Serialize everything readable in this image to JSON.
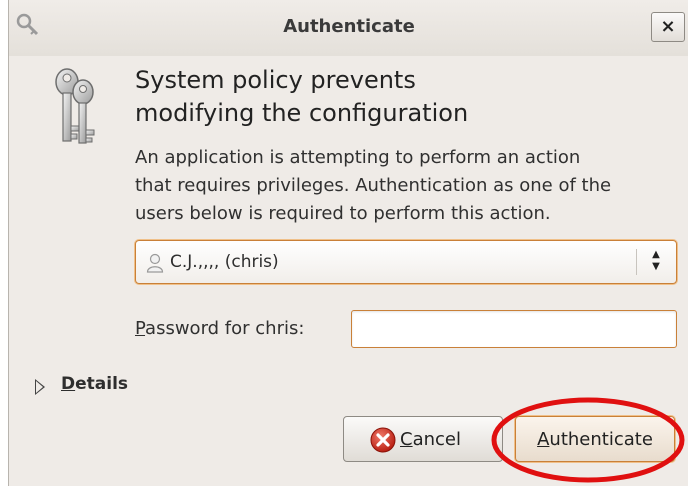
{
  "window": {
    "title": "Authenticate",
    "close_label": "×"
  },
  "dialog": {
    "heading_line1": "System policy prevents",
    "heading_line2": "modifying the configuration",
    "description_line1": "An application is attempting to perform an action",
    "description_line2": "that requires privileges. Authentication as one of the",
    "description_line3": "users below is required to perform this action.",
    "user_select": {
      "selected": "C.J.,,,, (chris)"
    },
    "password": {
      "label_mnemonic": "P",
      "label_rest": "assword for chris:",
      "value": ""
    },
    "details": {
      "label_mnemonic": "D",
      "label_rest": "etails"
    },
    "buttons": {
      "cancel_mnemonic": "C",
      "cancel_rest": "ancel",
      "authenticate_mnemonic": "A",
      "authenticate_rest": "uthenticate"
    }
  },
  "colors": {
    "focus": "#c98038",
    "annotation": "#e01010",
    "window_bg": "#efebe7"
  },
  "icons": {
    "title": "keys-small-icon",
    "dialog": "keys-icon",
    "user": "user-icon",
    "cancel": "cancel-icon",
    "select": "updown-arrows-icon",
    "details": "expander-triangle-icon"
  }
}
